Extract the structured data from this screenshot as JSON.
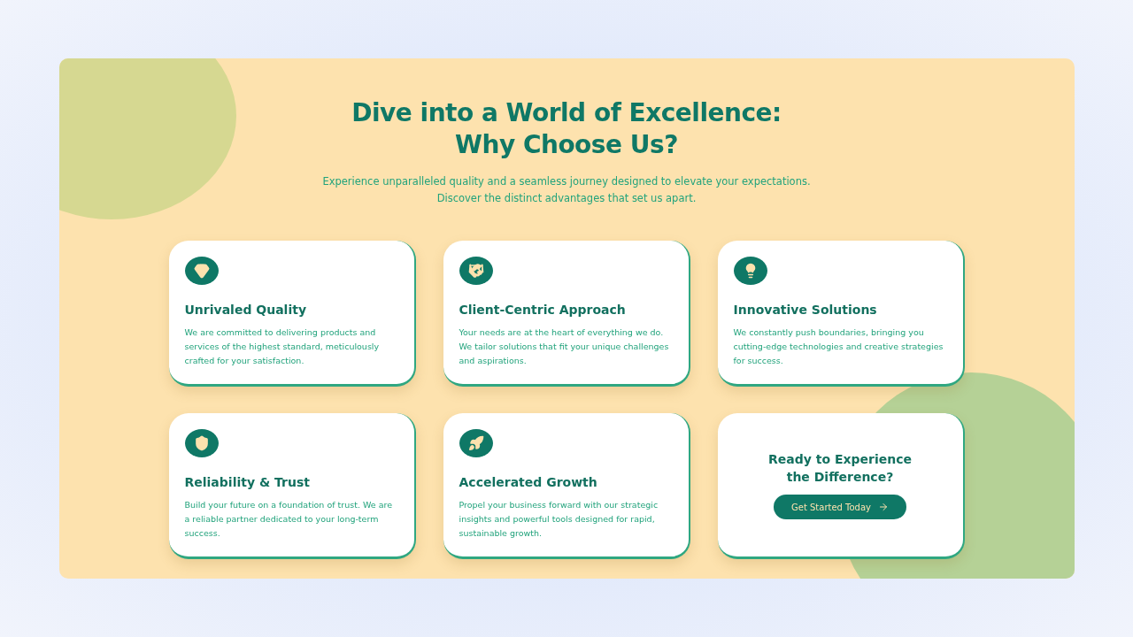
{
  "heading": {
    "line_1": "Dive into a World of Excellence:",
    "line_2": "Why Choose Us?"
  },
  "subtitle": {
    "line_1": "Experience unparalleled quality and a seamless journey designed to elevate your expectations.",
    "line_2": "Discover the distinct advantages that set us apart."
  },
  "cards": [
    {
      "kind": "feature",
      "title": "Unrivaled Quality",
      "description": "We are committed to delivering products and services of the highest standard, meticulously crafted for your satisfaction."
    },
    {
      "kind": "feature",
      "title": "Client-Centric Approach",
      "description": "Your needs are at the heart of everything we do. We tailor solutions that fit your unique challenges and aspirations."
    },
    {
      "kind": "feature",
      "title": "Innovative Solutions",
      "description": "We constantly push boundaries, bringing you cutting-edge technologies and creative strategies for success."
    },
    {
      "kind": "feature",
      "title": "Reliability & Trust",
      "description": "Build your future on a foundation of trust. We are a reliable partner dedicated to your long-term success."
    },
    {
      "kind": "feature",
      "title": "Accelerated Growth",
      "description": "Propel your business forward with our strategic insights and powerful tools designed for rapid, sustainable growth."
    },
    {
      "kind": "cta",
      "title": "Ready to Experience the Difference?",
      "button": "Get Started Today"
    }
  ]
}
